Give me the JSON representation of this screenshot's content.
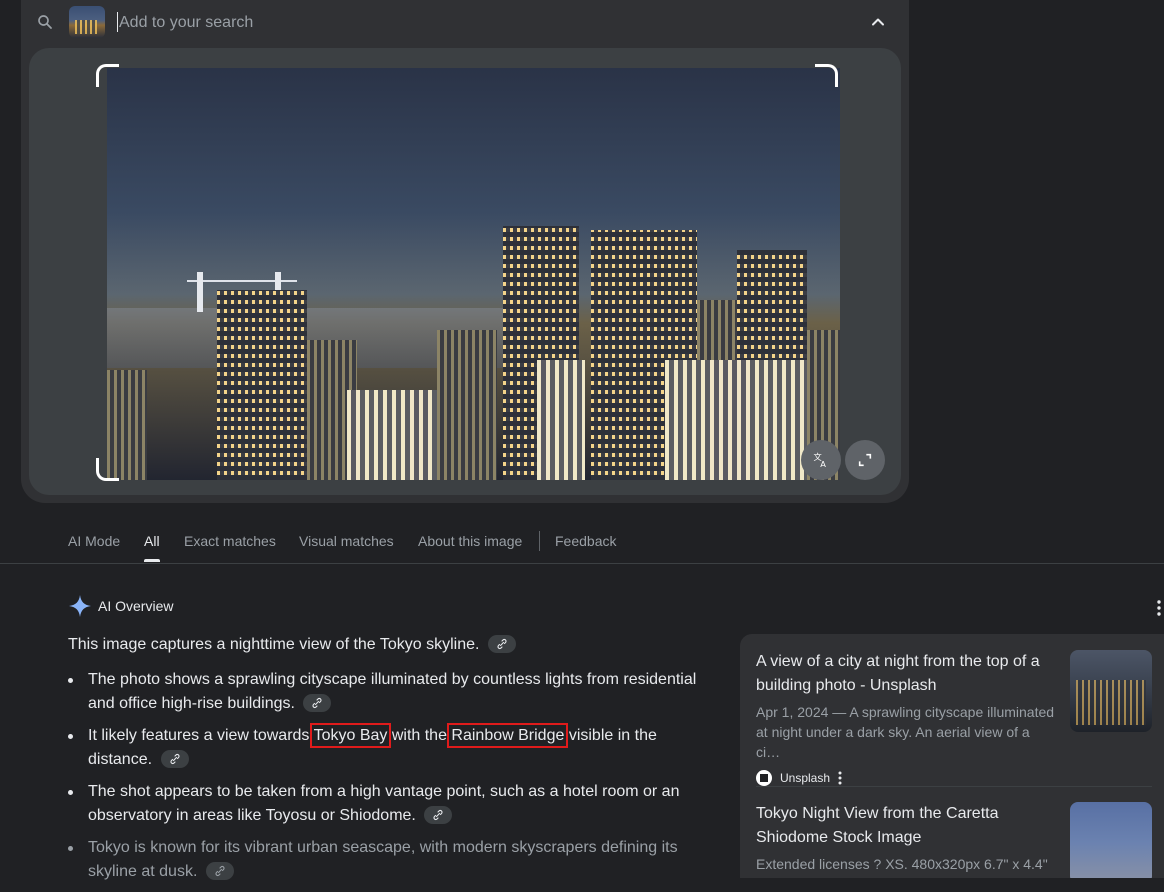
{
  "search": {
    "placeholder": "Add to your search"
  },
  "tabs": [
    {
      "label": "AI Mode"
    },
    {
      "label": "All",
      "active": true
    },
    {
      "label": "Exact matches"
    },
    {
      "label": "Visual matches"
    },
    {
      "label": "About this image"
    },
    {
      "label": "Feedback"
    }
  ],
  "ai_overview": {
    "title": "AI Overview",
    "intro": "This image captures a nighttime view of the Tokyo skyline.",
    "bullets": {
      "b1": "The photo shows a sprawling cityscape illuminated by countless lights from residential and office high-rise buildings.",
      "b2_pre": "It likely features a view towards ",
      "b2_hl1": "Tokyo Bay",
      "b2_mid": " with the ",
      "b2_hl2": "Rainbow Bridge",
      "b2_post": " visible in the distance.",
      "b3": "The shot appears to be taken from a high vantage point, such as a hotel room or an observatory in areas like Toyosu or Shiodome.",
      "b4": "Tokyo is known for its vibrant urban seascape, with modern skyscrapers defining its skyline at dusk."
    }
  },
  "results": [
    {
      "title": "A view of a city at night from the top of a building photo - Unsplash",
      "desc": "Apr 1, 2024 — A sprawling cityscape illuminated at night under a dark sky. An aerial view of a ci…",
      "source": "Unsplash"
    },
    {
      "title": "Tokyo Night View from the Caretta Shiodome Stock Image",
      "desc": "Extended licenses ? XS. 480x320px 6.7\" x 4.4\""
    }
  ],
  "icons": {
    "search": "search-icon",
    "collapse": "chevron-up-icon",
    "translate": "translate-icon",
    "expand": "expand-icon",
    "ai": "sparkle-icon",
    "more": "more-vert-icon",
    "link": "link-icon"
  },
  "colors": {
    "background": "#202124",
    "panel": "#303134",
    "highlight_box": "#e01b1b",
    "ai_sparkle": "#8ab4f8"
  }
}
